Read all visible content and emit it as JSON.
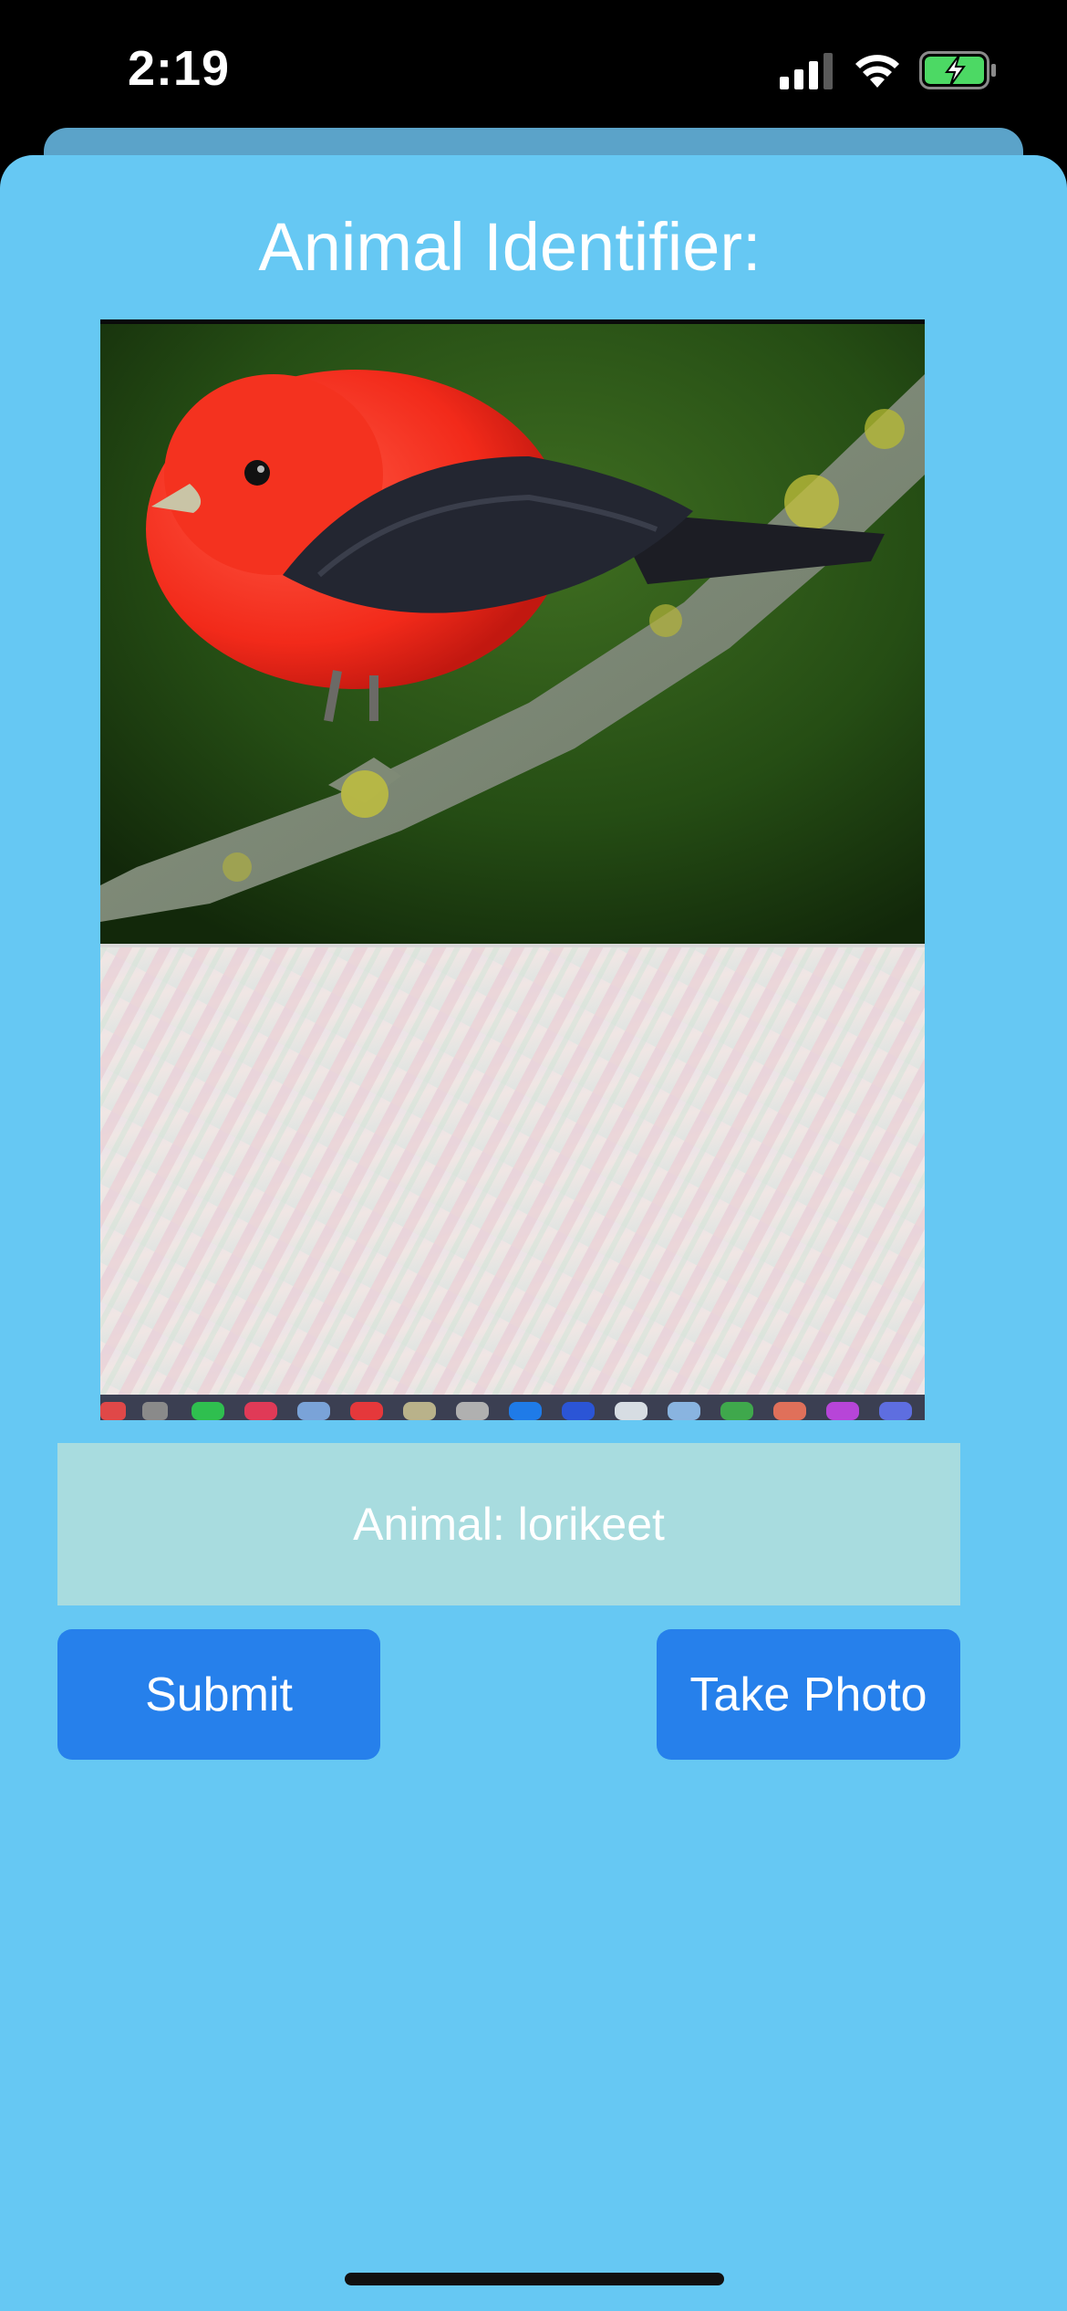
{
  "status_bar": {
    "time": "2:19",
    "icons": [
      "cellular-signal-icon",
      "wifi-icon",
      "battery-charging-icon"
    ],
    "battery_color": "#4cd964"
  },
  "app": {
    "title": "Animal Identifier:",
    "photo_subject": "bird-photo",
    "result_text": "Animal: lorikeet",
    "submit_label": "Submit",
    "take_photo_label": "Take Photo"
  },
  "colors": {
    "background": "#66c8f3",
    "button": "#2680eb",
    "result_field": "#a8dcdf",
    "text": "#ffffff"
  }
}
